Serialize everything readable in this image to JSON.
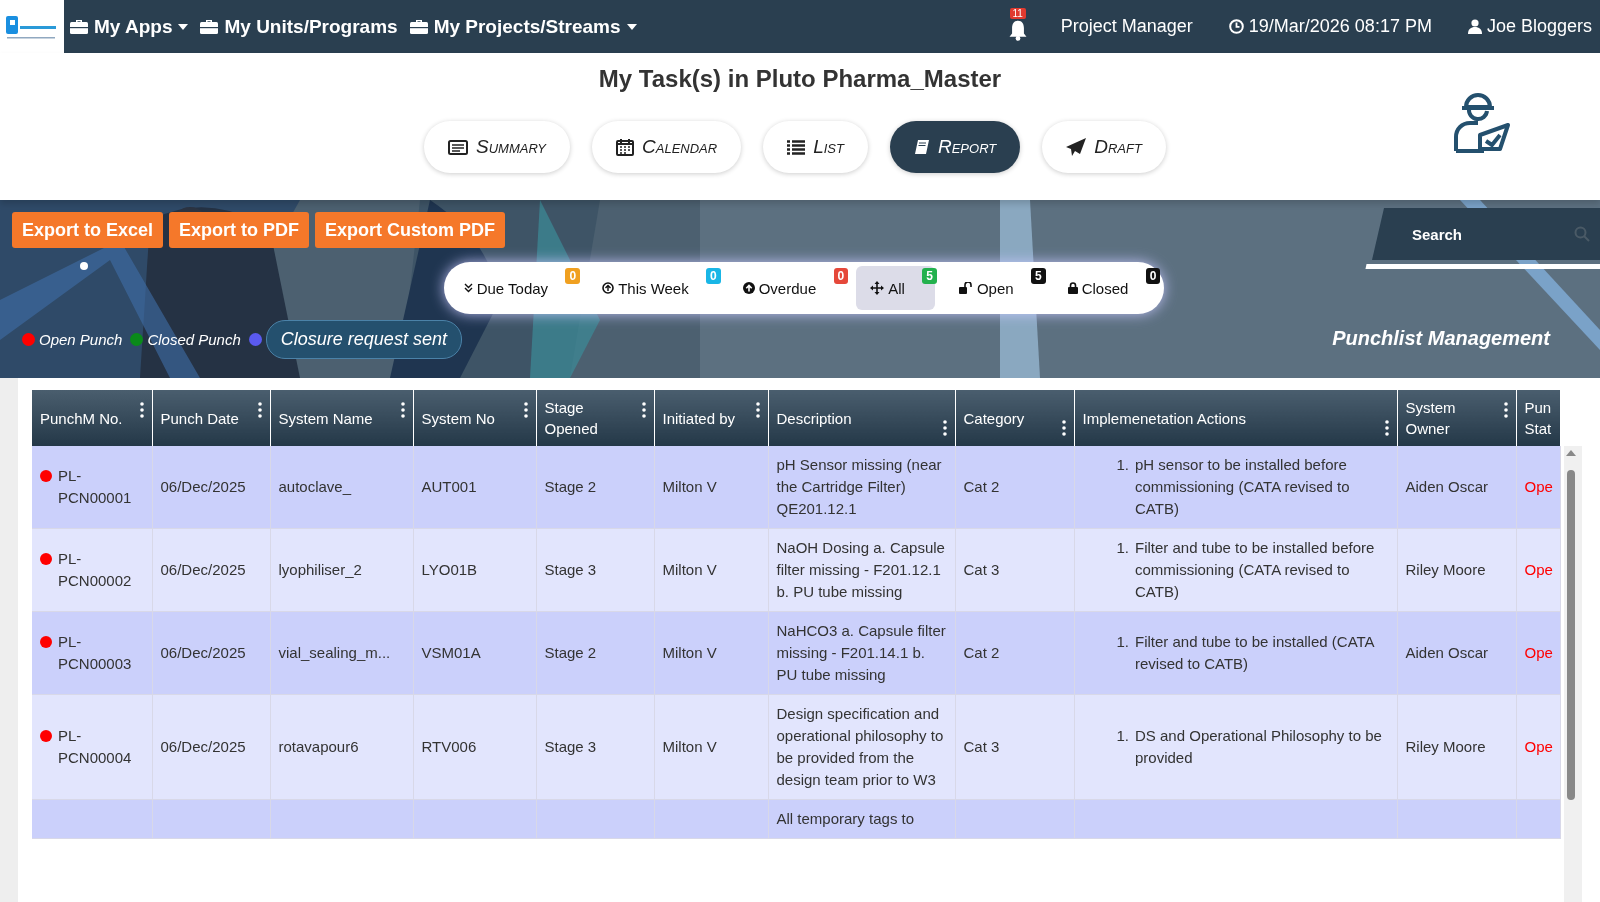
{
  "topbar": {
    "menus": [
      {
        "label": "My Apps",
        "dropdown": true
      },
      {
        "label": "My Units/Programs",
        "dropdown": false
      },
      {
        "label": "My Projects/Streams",
        "dropdown": true
      }
    ],
    "notifications": "11",
    "role": "Project Manager",
    "datetime": "19/Mar/2026 08:17 PM",
    "user": "Joe Bloggers"
  },
  "title": "My Task(s) in Pluto Pharma_Master",
  "views": [
    {
      "label": "Summary",
      "selected": false
    },
    {
      "label": "Calendar",
      "selected": false
    },
    {
      "label": "List",
      "selected": false
    },
    {
      "label": "Report",
      "selected": true
    },
    {
      "label": "Draft",
      "selected": false
    }
  ],
  "exports": [
    "Export to Excel",
    "Export to PDF",
    "Export Custom PDF"
  ],
  "filters": [
    {
      "label": "Due Today",
      "count": "0",
      "color": "#f0a020",
      "selected": false
    },
    {
      "label": "This Week",
      "count": "0",
      "color": "#19b6e6",
      "selected": false
    },
    {
      "label": "Overdue",
      "count": "0",
      "color": "#e5483a",
      "selected": false
    },
    {
      "label": "All",
      "count": "5",
      "color": "#23b14d",
      "selected": true
    },
    {
      "label": "Open",
      "count": "5",
      "color": "#111111",
      "selected": false
    },
    {
      "label": "Closed",
      "count": "0",
      "color": "#111111",
      "selected": false
    }
  ],
  "legend": [
    {
      "label": "Open Punch",
      "color": "#ff0000",
      "kind": "plain"
    },
    {
      "label": "Closed Punch",
      "color": "#0a8a1a",
      "kind": "plain"
    },
    {
      "label": "Closure request sent",
      "color": "#5a5af0",
      "kind": "pill"
    }
  ],
  "search": {
    "placeholder": "Search"
  },
  "banner_caption": "Punchlist Management",
  "table": {
    "columns": [
      {
        "label": "PunchM No.",
        "menu": true
      },
      {
        "label": "Punch Date",
        "menu": true
      },
      {
        "label": "System Name",
        "menu": true
      },
      {
        "label": "System No",
        "menu": true
      },
      {
        "label": "Stage Opened",
        "menu": true
      },
      {
        "label": "Initiated by",
        "menu": true
      },
      {
        "label": "Description",
        "menu": true
      },
      {
        "label": "Category",
        "menu": true
      },
      {
        "label": "Implemenetation Actions",
        "menu": true
      },
      {
        "label": "System Owner",
        "menu": true
      },
      {
        "label": "Pun Stat",
        "menu": false
      }
    ],
    "rows": [
      {
        "color": "#ff0000",
        "marker": "1.",
        "cells": [
          "PL-PCN00001",
          "06/Dec/2025",
          "autoclave_",
          "AUT001",
          "Stage 2",
          "Milton V",
          "pH Sensor missing (near the Cartridge Filter) QE201.12.1",
          "Cat 2",
          "pH sensor to be installed before commissioning (CATA revised to CATB)",
          "Aiden Oscar",
          "Ope"
        ]
      },
      {
        "color": "#ff0000",
        "marker": "1.",
        "cells": [
          "PL-PCN00002",
          "06/Dec/2025",
          "lyophiliser_2",
          "LYO01B",
          "Stage 3",
          "Milton V",
          "NaOH Dosing a. Capsule filter missing - F201.12.1 b. PU tube missing",
          "Cat 3",
          "Filter and tube to be installed before commissioning (CATA revised to CATB)",
          "Riley Moore",
          "Ope"
        ]
      },
      {
        "color": "#ff0000",
        "marker": "1.",
        "cells": [
          "PL-PCN00003",
          "06/Dec/2025",
          "vial_sealing_m...",
          "VSM01A",
          "Stage 2",
          "Milton V",
          "NaHCO3 a. Capsule filter missing - F201.14.1 b. PU tube missing",
          "Cat 2",
          "Filter and tube to be installed (CATA revised to CATB)",
          "Aiden Oscar",
          "Ope"
        ]
      },
      {
        "color": "#ff0000",
        "marker": "1.",
        "cells": [
          "PL-PCN00004",
          "06/Dec/2025",
          "rotavapour6",
          "RTV006",
          "Stage 3",
          "Milton V",
          "Design specification and operational philosophy to be provided from the design team prior to W3",
          "Cat 3",
          "DS and Operational Philosophy to be provided",
          "Riley Moore",
          "Ope"
        ]
      },
      {
        "cells": [
          "",
          "",
          "",
          "",
          "",
          "",
          "All temporary tags to",
          "",
          "",
          "",
          ""
        ]
      }
    ]
  }
}
